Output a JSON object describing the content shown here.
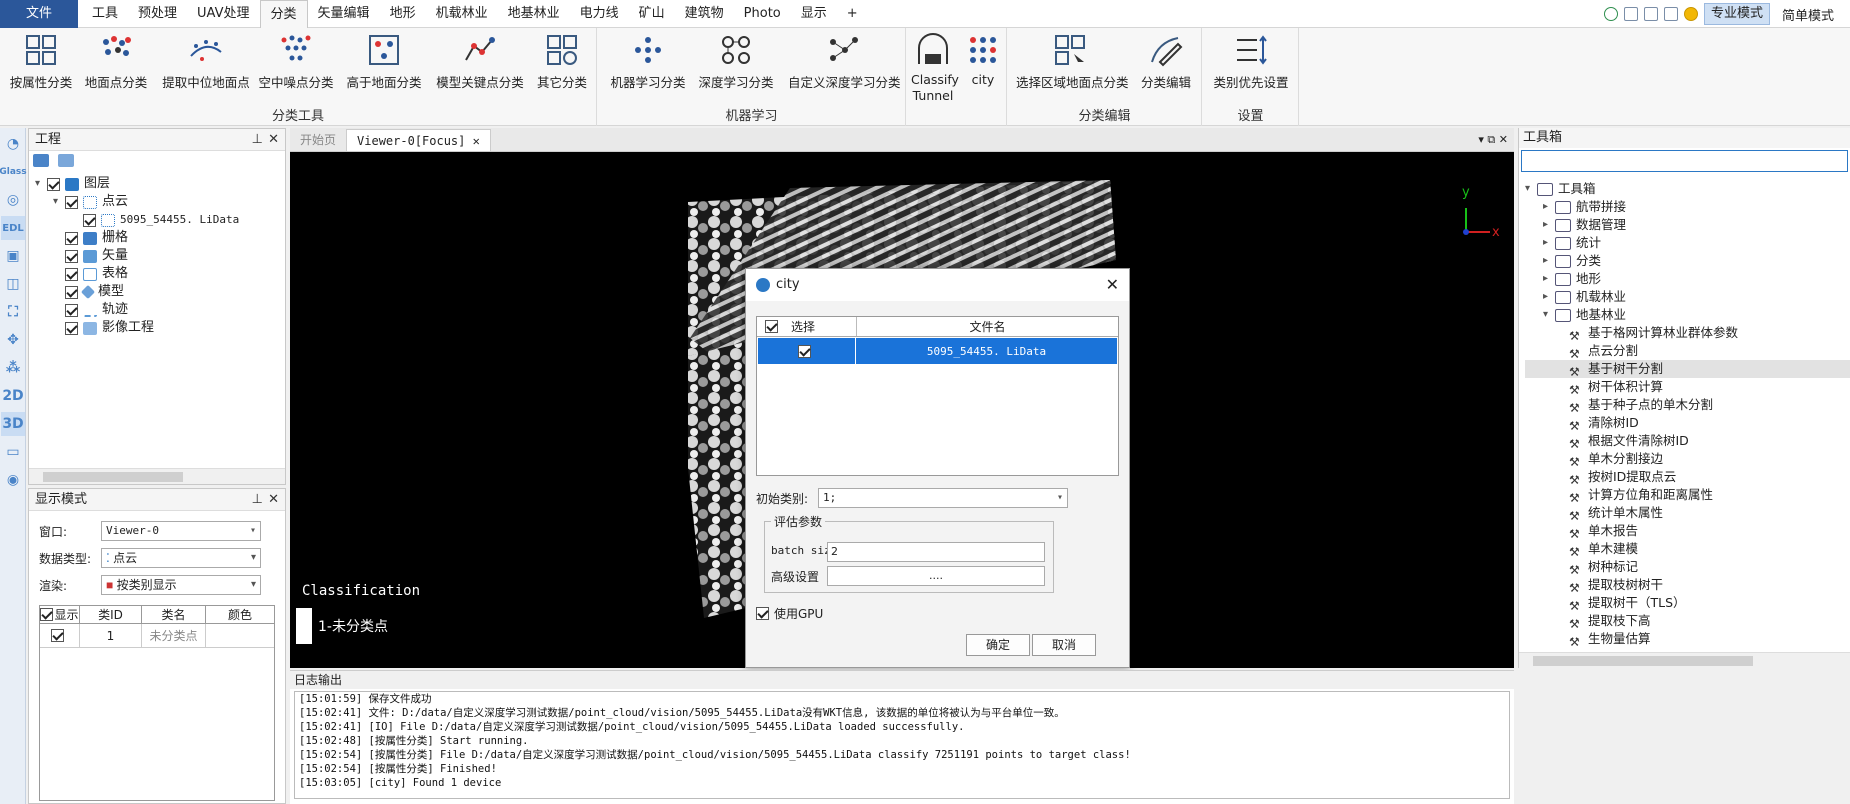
{
  "menu": [
    "文件",
    "工具",
    "预处理",
    "UAV处理",
    "分类",
    "矢量编辑",
    "地形",
    "机载林业",
    "地基林业",
    "电力线",
    "矿山",
    "建筑物",
    "Photo",
    "显示",
    "+"
  ],
  "menu_active": "分类",
  "mode": {
    "pro": "专业模式",
    "simple": "简单模式"
  },
  "ribbon": {
    "groups": [
      "分类工具",
      "机器学习",
      "分类编辑",
      "设置"
    ],
    "buttons": [
      "按属性分类",
      "地面点分类",
      "提取中位地面点",
      "空中噪点分类",
      "高于地面分类",
      "模型关键点分类",
      "其它分类",
      "机器学习分类",
      "深度学习分类",
      "自定义深度学习分类",
      "Classify Tunnel",
      "city",
      "选择区域地面点分类",
      "分类编辑",
      "类别优先设置"
    ]
  },
  "project": {
    "title": "工程",
    "items": [
      "图层",
      "点云",
      "5095_54455. LiData",
      "栅格",
      "矢量",
      "表格",
      "模型",
      "轨迹",
      "影像工程"
    ]
  },
  "display": {
    "title": "显示模式",
    "window_label": "窗口:",
    "window_value": "Viewer-0",
    "datatype_label": "数据类型:",
    "datatype_value": "点云",
    "render_label": "渲染:",
    "render_value": "按类别显示",
    "headers": [
      "显示",
      "类ID",
      "类名",
      "颜色"
    ],
    "row": {
      "id": "1",
      "name": "未分类点"
    }
  },
  "tabs": [
    "开始页",
    "Viewer-0[Focus]"
  ],
  "viewer": {
    "legend_title": "Classification",
    "legend_item": "1-未分类点",
    "axis_y": "y",
    "axis_x": "x"
  },
  "dialog": {
    "title": "city",
    "col_select": "选择",
    "col_file": "文件名",
    "file": "5095_54455. LiData",
    "init_label": "初始类别:",
    "init_value": "1;",
    "group_label": "评估参数",
    "batch_label": "batch size",
    "batch_value": "2",
    "adv_label": "高级设置",
    "adv_value": "....",
    "gpu_label": "使用GPU",
    "ok": "确定",
    "cancel": "取消"
  },
  "log": {
    "title": "日志输出",
    "lines": [
      "[15:01:59] 保存文件成功",
      "[15:02:41] 文件: D:/data/自定义深度学习测试数据/point_cloud/vision/5095_54455.LiData没有WKT信息, 该数据的单位将被认为与平台单位一致。",
      "[15:02:41] [IO]    File D:/data/自定义深度学习测试数据/point_cloud/vision/5095_54455.LiData loaded successfully.",
      "[15:02:48] [按属性分类]    Start running.",
      "[15:02:54] [按属性分类]    File D:/data/自定义深度学习测试数据/point_cloud/vision/5095_54455.LiData classify 7251191 points to target class!",
      "[15:02:54] [按属性分类]    Finished!",
      "[15:03:05] [city]    Found 1 device"
    ]
  },
  "toolbox": {
    "title": "工具箱",
    "root": "工具箱",
    "folders": [
      "航带拼接",
      "数据管理",
      "统计",
      "分类",
      "地形",
      "机载林业",
      "地基林业"
    ],
    "tools": [
      "基于格网计算林业群体参数",
      "点云分割",
      "基于树干分割",
      "树干体积计算",
      "基于种子点的单木分割",
      "清除树ID",
      "根据文件清除树ID",
      "单木分割接边",
      "按树ID提取点云",
      "计算方位角和距离属性",
      "统计单木属性",
      "单木报告",
      "单木建模",
      "树种标记",
      "提取枝树树干",
      "提取树干（TLS）",
      "提取枝下高",
      "生物量估算"
    ],
    "selected": "基于树干分割"
  }
}
